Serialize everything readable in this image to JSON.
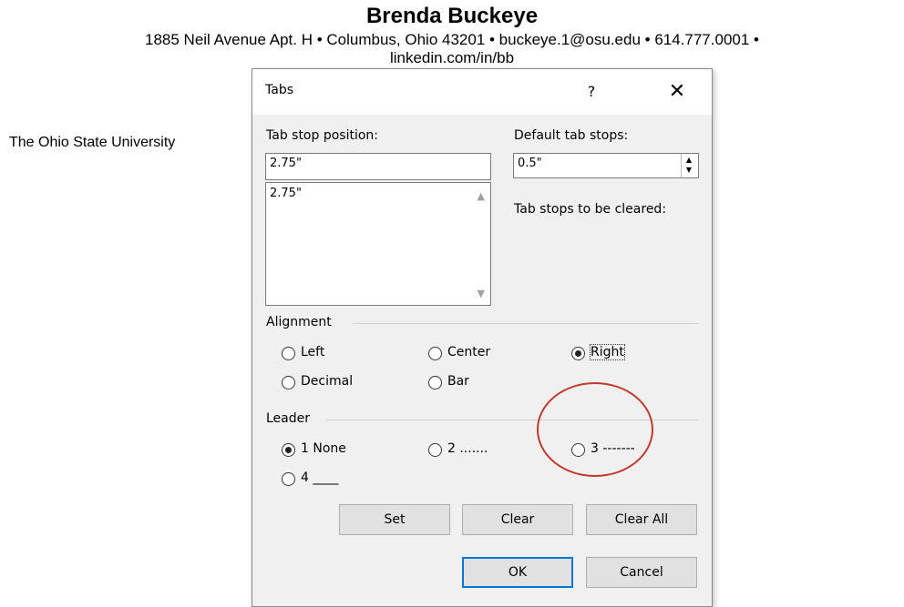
{
  "document": {
    "name": "Brenda Buckeye",
    "contact": "1885 Neil Avenue Apt. H • Columbus, Ohio 43201 • buckeye.1@osu.edu • 614.777.0001 •",
    "contact_partial": "linkedin.com/in/bb",
    "school": "The Ohio State University"
  },
  "dialog": {
    "title": "Tabs",
    "help_icon": "?",
    "close_icon": "✕",
    "tab_stop_position": {
      "label": "Tab stop position:",
      "value": "2.75\"",
      "list": [
        "2.75\""
      ]
    },
    "default_tab_stops": {
      "label": "Default tab stops:",
      "value": "0.5\""
    },
    "tab_stops_cleared_label": "Tab stops to be cleared:",
    "alignment": {
      "label": "Alignment",
      "options": [
        {
          "label": "Left",
          "selected": false
        },
        {
          "label": "Center",
          "selected": false
        },
        {
          "label": "Right",
          "selected": true
        },
        {
          "label": "Decimal",
          "selected": false
        },
        {
          "label": "Bar",
          "selected": false
        }
      ]
    },
    "leader": {
      "label": "Leader",
      "options": [
        {
          "label": "1 None",
          "selected": true
        },
        {
          "label": "2 .......",
          "selected": false
        },
        {
          "label": "3 -------",
          "selected": false
        },
        {
          "label": "4 ____",
          "selected": false
        }
      ]
    },
    "buttons": {
      "set": "Set",
      "clear": "Clear",
      "clear_all": "Clear All",
      "ok": "OK",
      "cancel": "Cancel"
    }
  },
  "colors": {
    "annotation": "#c0392b",
    "dialog_bg": "#f0f0f0",
    "default_button_border": "#0078d7"
  }
}
